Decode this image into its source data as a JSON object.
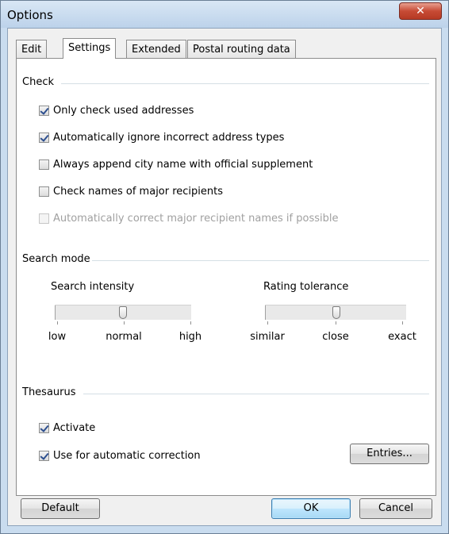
{
  "window": {
    "title": "Options",
    "close_glyph": "✕"
  },
  "tabs": [
    {
      "label": "Edit",
      "active": false
    },
    {
      "label": "Settings",
      "active": true
    },
    {
      "label": "Extended",
      "active": false
    },
    {
      "label": "Postal routing data",
      "active": false
    }
  ],
  "check_group": {
    "label": "Check",
    "items": [
      {
        "label": "Only check used addresses",
        "checked": true,
        "enabled": true
      },
      {
        "label": "Automatically ignore incorrect address types",
        "checked": true,
        "enabled": true
      },
      {
        "label": "Always append city name with official supplement",
        "checked": false,
        "enabled": true
      },
      {
        "label": "Check names of major recipients",
        "checked": false,
        "enabled": true
      },
      {
        "label": "Automatically correct major recipient names if possible",
        "checked": false,
        "enabled": false
      }
    ]
  },
  "search_group": {
    "label": "Search mode",
    "intensity": {
      "label": "Search intensity",
      "ticks": [
        "low",
        "normal",
        "high"
      ],
      "value": "normal",
      "value_index": 1
    },
    "tolerance": {
      "label": "Rating tolerance",
      "ticks": [
        "similar",
        "close",
        "exact"
      ],
      "value": "close",
      "value_index": 1
    }
  },
  "thesaurus_group": {
    "label": "Thesaurus",
    "activate": {
      "label": "Activate",
      "checked": true
    },
    "auto_correct": {
      "label": "Use for automatic correction",
      "checked": true
    },
    "entries_button": "Entries..."
  },
  "footer": {
    "default_button": "Default",
    "ok_button": "OK",
    "cancel_button": "Cancel"
  },
  "colors": {
    "title_bar": "#c9dcef",
    "close_button": "#c74b35",
    "default_button_border": "#3c7fb1"
  }
}
